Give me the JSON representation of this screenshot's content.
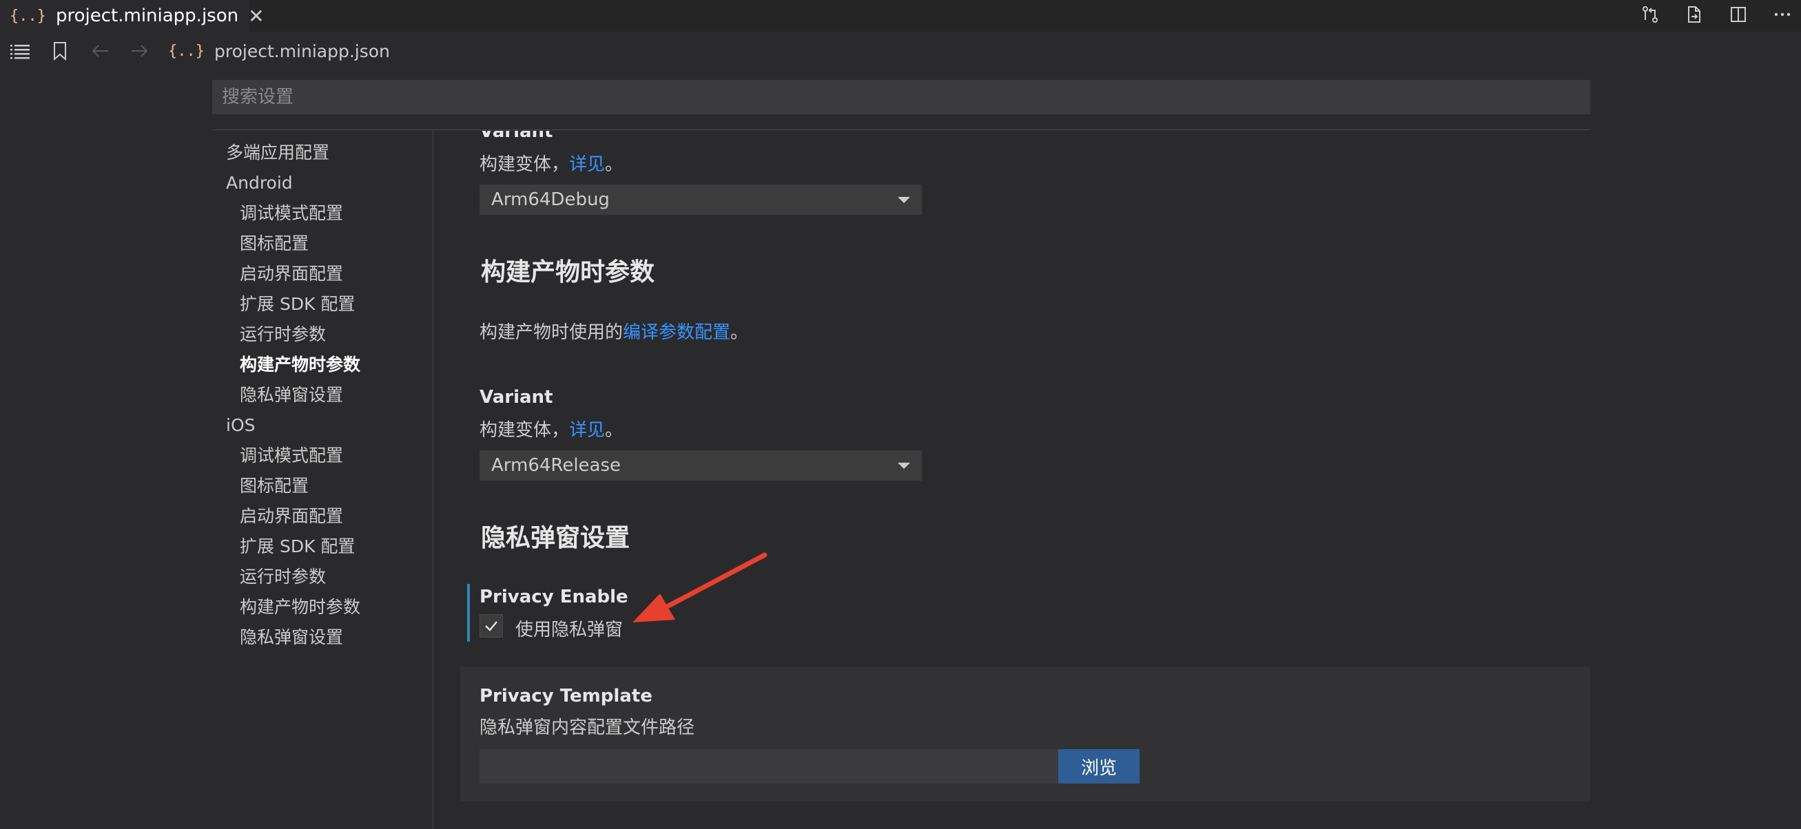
{
  "tab": {
    "label": "project.miniapp.json",
    "icon": "{..}",
    "close": "✕"
  },
  "breadcrumb": {
    "icon": "{..}",
    "file": "project.miniapp.json"
  },
  "search": {
    "placeholder": "搜索设置"
  },
  "nav": {
    "items": [
      {
        "label": "多端应用配置"
      },
      {
        "label": "Android"
      },
      {
        "label": "调试模式配置"
      },
      {
        "label": "图标配置"
      },
      {
        "label": "启动界面配置"
      },
      {
        "label": "扩展 SDK 配置"
      },
      {
        "label": "运行时参数"
      },
      {
        "label": "构建产物时参数"
      },
      {
        "label": "隐私弹窗设置"
      },
      {
        "label": "iOS"
      },
      {
        "label": "调试模式配置"
      },
      {
        "label": "图标配置"
      },
      {
        "label": "启动界面配置"
      },
      {
        "label": "扩展 SDK 配置"
      },
      {
        "label": "运行时参数"
      },
      {
        "label": "构建产物时参数"
      },
      {
        "label": "隐私弹窗设置"
      }
    ]
  },
  "content": {
    "variant1": {
      "title": "Variant",
      "desc_prefix": "构建变体，",
      "desc_link": "详见",
      "desc_suffix": "。",
      "value": "Arm64Debug"
    },
    "build_section": {
      "title": "构建产物时参数",
      "desc_prefix": "构建产物时使用的",
      "desc_link": "编译参数配置",
      "desc_suffix": "。"
    },
    "variant2": {
      "title": "Variant",
      "desc_prefix": "构建变体，",
      "desc_link": "详见",
      "desc_suffix": "。",
      "value": "Arm64Release"
    },
    "privacy_section": {
      "title": "隐私弹窗设置"
    },
    "privacy_enable": {
      "title": "Privacy Enable",
      "checkbox_label": "使用隐私弹窗",
      "checked": true
    },
    "privacy_template": {
      "title": "Privacy Template",
      "desc": "隐私弹窗内容配置文件路径",
      "value": "",
      "browse_label": "浏览"
    }
  },
  "colors": {
    "accent_link": "#3794ff",
    "button": "#2f5d95",
    "arrow": "#e8402f"
  }
}
